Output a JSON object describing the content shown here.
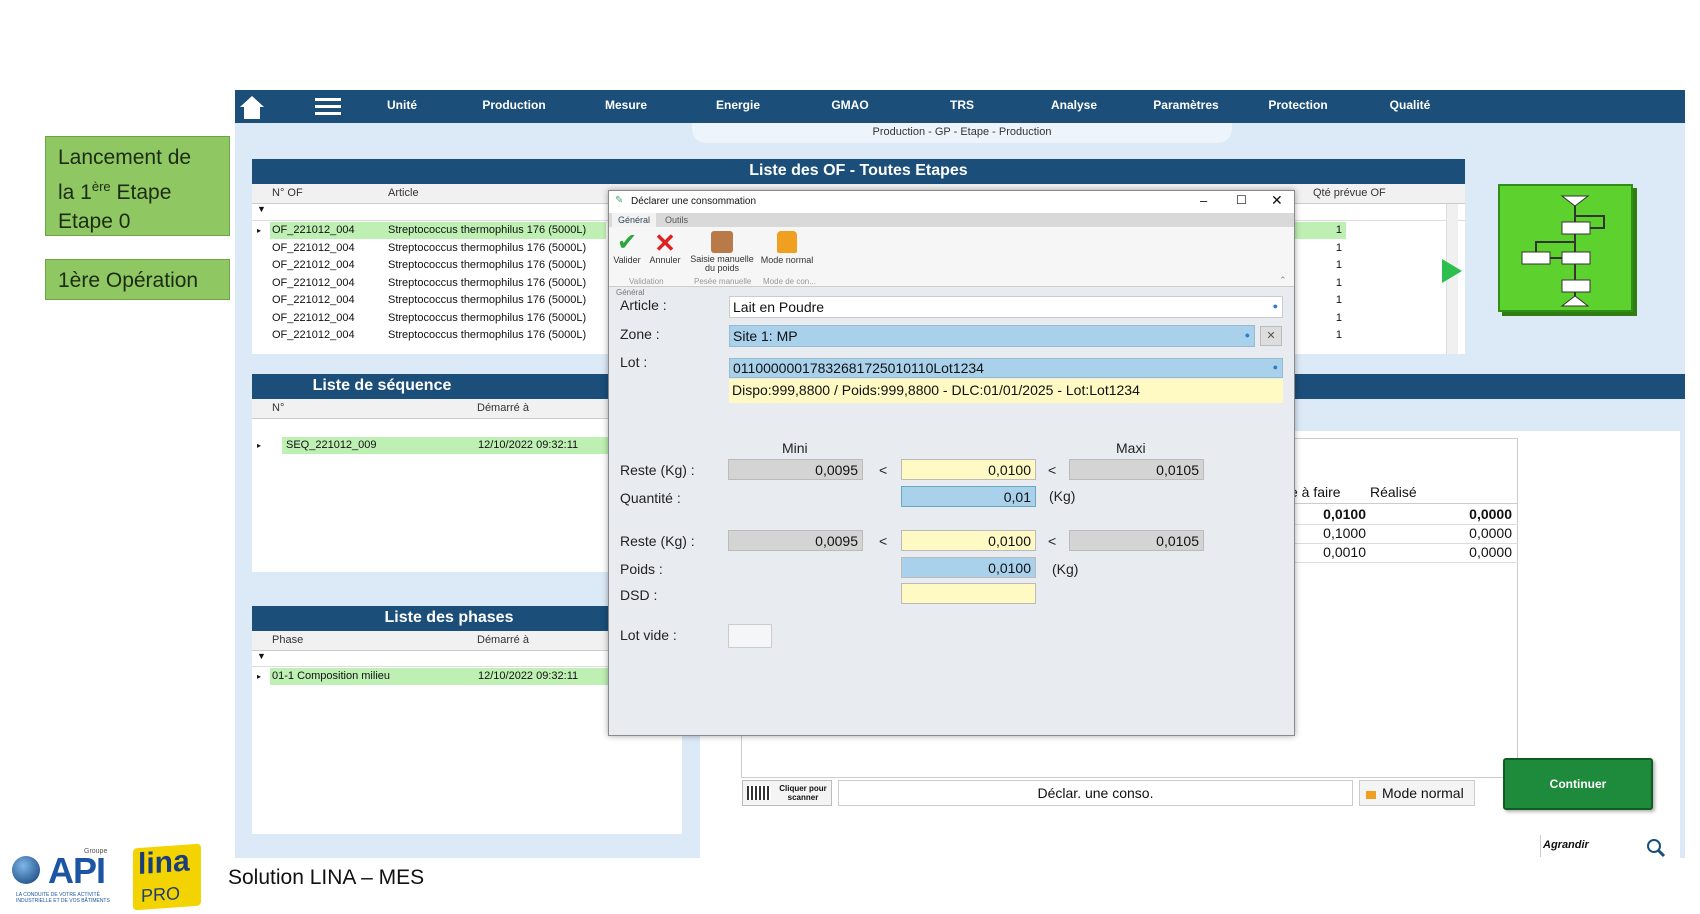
{
  "side_labels": {
    "launch_line1": "Lancement de",
    "launch_line2_pre": "la 1",
    "launch_sup": "ère",
    "launch_line2_post": " Etape",
    "launch_line3": "Etape 0",
    "first_op": "1ère Opération"
  },
  "nav": [
    "Unité",
    "Production",
    "Mesure",
    "Energie",
    "GMAO",
    "TRS",
    "Analyse",
    "Paramètres",
    "Protection",
    "Qualité"
  ],
  "breadcrumb": "Production - GP - Etape - Production",
  "of_panel": {
    "title": "Liste des OF - Toutes Etapes",
    "col_of": "N° OF",
    "col_article": "Article",
    "col_qty": "Qté prévue OF",
    "rows": [
      {
        "of": "OF_221012_004",
        "article": "Streptococcus thermophilus 176 (5000L)",
        "qty": "1"
      },
      {
        "of": "OF_221012_004",
        "article": "Streptococcus thermophilus 176 (5000L)",
        "qty": "1"
      },
      {
        "of": "OF_221012_004",
        "article": "Streptococcus thermophilus 176 (5000L)",
        "qty": "1"
      },
      {
        "of": "OF_221012_004",
        "article": "Streptococcus thermophilus 176 (5000L)",
        "qty": "1"
      },
      {
        "of": "OF_221012_004",
        "article": "Streptococcus thermophilus 176 (5000L)",
        "qty": "1"
      },
      {
        "of": "OF_221012_004",
        "article": "Streptococcus thermophilus 176 (5000L)",
        "qty": "1"
      },
      {
        "of": "OF_221012_004",
        "article": "Streptococcus thermophilus 176 (5000L)",
        "qty": "1"
      }
    ]
  },
  "seq_panel": {
    "title": "Liste de séquence",
    "col_no": "N°",
    "col_start": "Démarré à",
    "row": {
      "no": "SEQ_221012_009",
      "start": "12/10/2022 09:32:11"
    }
  },
  "phase_panel": {
    "title": "Liste des phases",
    "col_phase": "Phase",
    "col_start": "Démarré à",
    "row": {
      "phase": "01-1 Composition milieu",
      "start": "12/10/2022 09:32:11"
    }
  },
  "right_table": {
    "col_todo": "e à faire",
    "col_done": "Réalisé",
    "rows": [
      {
        "todo": "0,0100",
        "done": "0,0000"
      },
      {
        "todo": "0,1000",
        "done": "0,0000"
      },
      {
        "todo": "0,0010",
        "done": "0,0000"
      }
    ]
  },
  "bottom_bar": {
    "scan_label": "Cliquer pour scanner",
    "status": "Déclar. une conso.",
    "mode": "Mode normal",
    "continue": "Continuer",
    "zoom": "Agrandir"
  },
  "dialog": {
    "title": "Déclarer une consommation",
    "tabs": [
      "Général",
      "Outils"
    ],
    "buttons": {
      "validate": "Valider",
      "cancel": "Annuler",
      "manual_weigh": "Saisie manuelle du poids",
      "normal_mode": "Mode normal"
    },
    "groups": {
      "validation": "Validation",
      "manual": "Pesée manuelle",
      "mode": "Mode de con..."
    },
    "section": "Général",
    "article_label": "Article :",
    "article_value": "Lait en Poudre",
    "zone_label": "Zone :",
    "zone_value": "Site 1: MP",
    "lot_label": "Lot :",
    "lot_value": "01100000017832681725010110Lot1234",
    "lot_info": "Dispo:999,8800 / Poids:999,8800 - DLC:01/01/2025 - Lot:Lot1234",
    "mini_label": "Mini",
    "maxi_label": "Maxi",
    "lt": "<",
    "reste_label": "Reste (Kg) :",
    "reste1": {
      "mini": "0,0095",
      "value": "0,0100",
      "maxi": "0,0105"
    },
    "quantite_label": "Quantité :",
    "quantite_value": "0,01",
    "kg": "(Kg)",
    "reste2": {
      "mini": "0,0095",
      "value": "0,0100",
      "maxi": "0,0105"
    },
    "poids_label": "Poids :",
    "poids_value": "0,0100",
    "dsd_label": "DSD :",
    "lot_vide_label": "Lot vide :"
  },
  "footer": {
    "company": "API",
    "group_label": "Groupe",
    "tagline": "LA CONDUITE DE VOTRE ACTIVITÉ INDUSTRIELLE ET DE VOS BÂTIMENTS",
    "product": "lina",
    "product_sub": "PRO",
    "solution": "Solution LINA – MES"
  },
  "colors": {
    "navy": "#1b4f7a",
    "green_row": "#bff0b3",
    "accent_green": "#1e8a3c",
    "label_green": "#8fc862"
  }
}
